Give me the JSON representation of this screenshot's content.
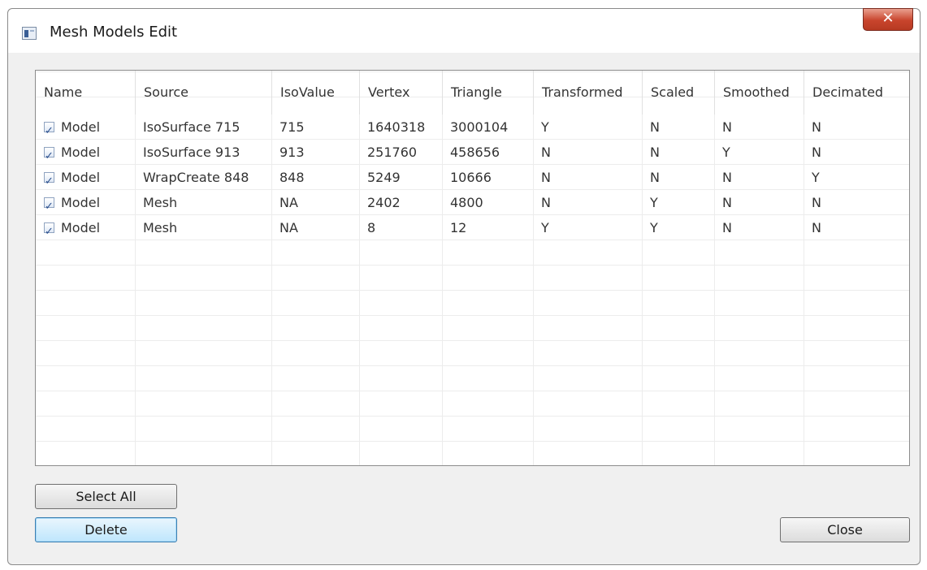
{
  "window": {
    "title": "Mesh Models Edit",
    "close_glyph": "✕"
  },
  "table": {
    "columns": [
      "Name",
      "Source",
      "IsoValue",
      "Vertex",
      "Triangle",
      "Transformed",
      "Scaled",
      "Smoothed",
      "Decimated"
    ],
    "rows": [
      {
        "checked": true,
        "cells": [
          "Model",
          "IsoSurface 715",
          "715",
          "1640318",
          "3000104",
          "Y",
          "N",
          "N",
          "N"
        ]
      },
      {
        "checked": true,
        "cells": [
          "Model",
          "IsoSurface 913",
          "913",
          "251760",
          "458656",
          "N",
          "N",
          "Y",
          "N"
        ]
      },
      {
        "checked": true,
        "cells": [
          "Model",
          "WrapCreate 848",
          "848",
          "5249",
          "10666",
          "N",
          "N",
          "N",
          "Y"
        ]
      },
      {
        "checked": true,
        "cells": [
          "Model",
          "Mesh",
          "NA",
          "2402",
          "4800",
          "N",
          "Y",
          "N",
          "N"
        ]
      },
      {
        "checked": true,
        "cells": [
          "Model",
          "Mesh",
          "NA",
          "8",
          "12",
          "Y",
          "Y",
          "N",
          "N"
        ]
      }
    ]
  },
  "buttons": {
    "select_all": "Select All",
    "delete": "Delete",
    "close": "Close"
  },
  "icons": {
    "app": "window-app-icon",
    "close": "close-icon",
    "checkbox": "checkbox-checked-icon"
  },
  "colors": {
    "close_button": "#c8442c",
    "focus_button": "#bee6fd"
  }
}
